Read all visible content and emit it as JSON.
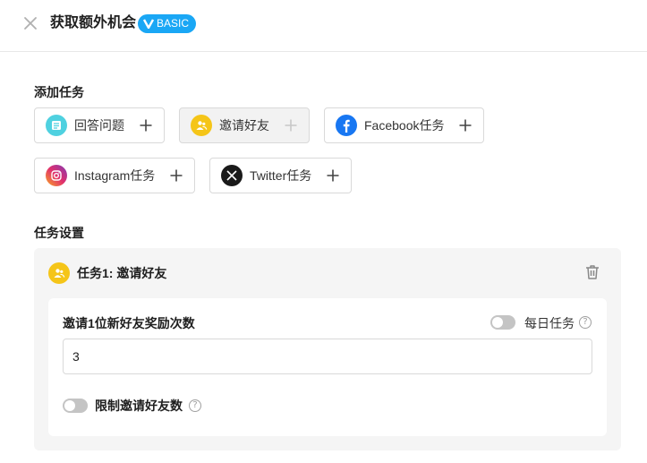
{
  "header": {
    "title": "获取额外机会",
    "badge": "BASIC"
  },
  "add_tasks": {
    "label": "添加任务",
    "buttons": [
      {
        "label": "回答问题",
        "icon": "question-icon",
        "color": "#4fd1e0"
      },
      {
        "label": "邀请好友",
        "icon": "invite-friends-icon",
        "color": "#f5c518",
        "disabled": true
      },
      {
        "label": "Facebook任务",
        "icon": "facebook-icon",
        "color": "#1877f2"
      },
      {
        "label": "Instagram任务",
        "icon": "instagram-icon",
        "color": "#e1306c"
      },
      {
        "label": "Twitter任务",
        "icon": "x-twitter-icon",
        "color": "#111111"
      }
    ]
  },
  "task_settings": {
    "label": "任务设置",
    "card": {
      "title": "任务1: 邀请好友",
      "reward_label": "邀请1位新好友奖励次数",
      "daily_label": "每日任务",
      "reward_value": "3",
      "limit_label": "限制邀请好友数"
    }
  },
  "colors": {
    "accent": "#1aa7f5",
    "invite_yellow": "#f5c518"
  }
}
